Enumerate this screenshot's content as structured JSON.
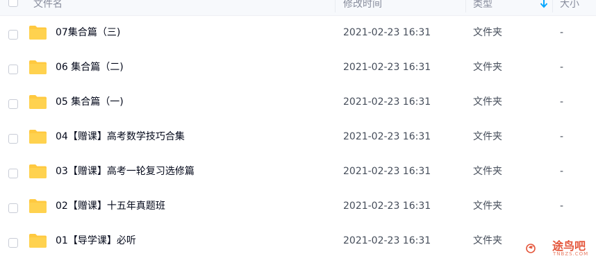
{
  "header": {
    "name_label": "文件名",
    "time_label": "修改时间",
    "type_label": "类型",
    "size_label": "大小",
    "sort_icon": "arrow-down-icon"
  },
  "rows": [
    {
      "name": "07集合篇（三)",
      "time": "2021-02-23 16:31",
      "type": "文件夹",
      "size": "-"
    },
    {
      "name": "06 集合篇（二)",
      "time": "2021-02-23 16:31",
      "type": "文件夹",
      "size": "-"
    },
    {
      "name": "05 集合篇（一)",
      "time": "2021-02-23 16:31",
      "type": "文件夹",
      "size": "-"
    },
    {
      "name": "04【赠课】高考数学技巧合集",
      "time": "2021-02-23 16:31",
      "type": "文件夹",
      "size": "-"
    },
    {
      "name": "03【赠课】高考一轮复习选修篇",
      "time": "2021-02-23 16:31",
      "type": "文件夹",
      "size": "-"
    },
    {
      "name": "02【赠课】十五年真题班",
      "time": "2021-02-23 16:31",
      "type": "文件夹",
      "size": "-"
    },
    {
      "name": "01【导学课】必听",
      "time": "2021-02-23 16:31",
      "type": "文件夹",
      "size": "-"
    }
  ],
  "watermark": {
    "text": "途鸟吧",
    "sub": "TNBZS.COM"
  },
  "colors": {
    "folder": "#ffc940",
    "sort_arrow": "#06a7ff",
    "watermark": "#e4553a"
  }
}
